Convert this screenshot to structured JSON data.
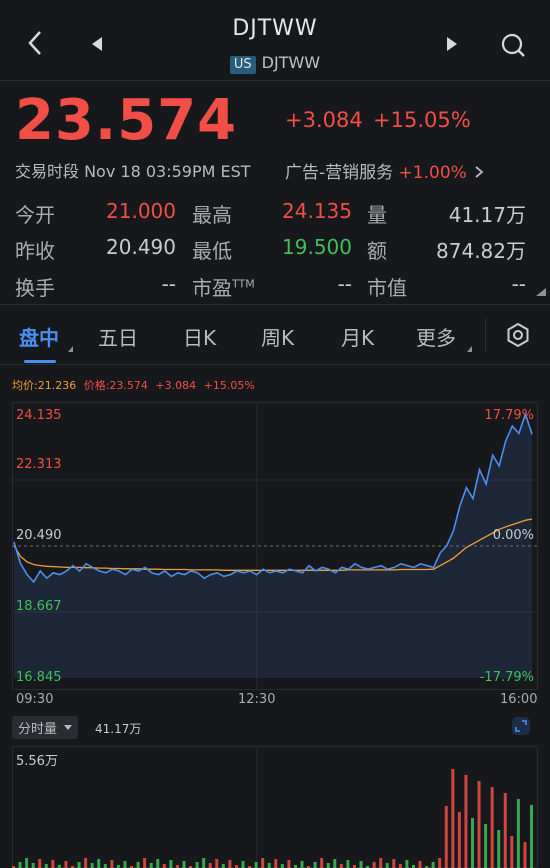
{
  "header": {
    "title": "DJTWW",
    "market_badge": "US",
    "subtitle": "DJTWW"
  },
  "quote": {
    "price": "23.574",
    "change": "+3.084",
    "change_pct": "+15.05%",
    "session": "交易时段 Nov 18 03:59PM EST",
    "sector_name": "广告-营销服务",
    "sector_change": "+1.00%"
  },
  "stats": {
    "open_label": "今开",
    "open_value": "21.000",
    "high_label": "最高",
    "high_value": "24.135",
    "volume_label": "量",
    "volume_value": "41.17万",
    "prev_label": "昨收",
    "prev_value": "20.490",
    "low_label": "最低",
    "low_value": "19.500",
    "amount_label": "额",
    "amount_value": "874.82万",
    "turnover_label": "换手",
    "turnover_value": "--",
    "pe_label": "市盈",
    "pe_sup": "TTM",
    "pe_value": "--",
    "mcap_label": "市值",
    "mcap_value": "--"
  },
  "tabs": {
    "intraday": "盘中",
    "five_day": "五日",
    "day_k": "日K",
    "week_k": "周K",
    "month_k": "月K",
    "more": "更多"
  },
  "legend": {
    "avg": "均价:21.236",
    "price": "价格:23.574",
    "change": "+3.084",
    "pct": "+15.05%"
  },
  "chart_data": {
    "type": "line",
    "y_labels_left": [
      "24.135",
      "22.313",
      "20.490",
      "18.667",
      "16.845"
    ],
    "y_labels_right": [
      "17.79%",
      "0.00%",
      "-17.79%"
    ],
    "x_labels": [
      "09:30",
      "12:30",
      "16:00"
    ],
    "ylim": [
      16.845,
      24.135
    ],
    "prev_close": 20.49,
    "series": [
      {
        "name": "价格",
        "values": [
          20.6,
          20.0,
          19.7,
          19.5,
          19.8,
          19.6,
          19.75,
          19.7,
          19.8,
          19.95,
          19.8,
          20.0,
          19.9,
          19.8,
          19.75,
          19.85,
          19.8,
          19.7,
          19.85,
          19.8,
          19.9,
          19.75,
          19.7,
          19.8,
          19.65,
          19.75,
          19.7,
          19.8,
          19.75,
          19.6,
          19.7,
          19.75,
          19.65,
          19.7,
          19.8,
          19.75,
          19.8,
          19.7,
          19.85,
          19.75,
          19.8,
          19.75,
          19.85,
          19.8,
          19.75,
          19.95,
          19.8,
          19.9,
          19.85,
          19.75,
          19.9,
          19.85,
          20.0,
          19.9,
          19.85,
          19.9,
          19.95,
          19.85,
          19.9,
          20.0,
          19.95,
          19.9,
          20.0,
          19.95,
          19.9,
          20.3,
          20.5,
          20.9,
          21.6,
          22.1,
          21.8,
          22.6,
          22.2,
          23.0,
          22.7,
          23.4,
          23.8,
          23.6,
          24.135,
          23.574
        ]
      },
      {
        "name": "均价",
        "values": [
          20.5,
          20.2,
          20.05,
          19.98,
          19.95,
          19.93,
          19.92,
          19.91,
          19.9,
          19.9,
          19.9,
          19.89,
          19.89,
          19.88,
          19.88,
          19.87,
          19.87,
          19.86,
          19.86,
          19.86,
          19.85,
          19.85,
          19.85,
          19.84,
          19.84,
          19.84,
          19.84,
          19.83,
          19.83,
          19.83,
          19.83,
          19.83,
          19.82,
          19.82,
          19.82,
          19.82,
          19.82,
          19.82,
          19.82,
          19.82,
          19.82,
          19.82,
          19.82,
          19.82,
          19.82,
          19.82,
          19.82,
          19.82,
          19.82,
          19.82,
          19.82,
          19.83,
          19.83,
          19.83,
          19.83,
          19.83,
          19.83,
          19.83,
          19.83,
          19.84,
          19.84,
          19.84,
          19.84,
          19.84,
          19.85,
          19.95,
          20.05,
          20.15,
          20.3,
          20.45,
          20.55,
          20.65,
          20.75,
          20.85,
          20.95,
          21.02,
          21.08,
          21.14,
          21.2,
          21.236
        ]
      }
    ]
  },
  "volume": {
    "selector": "分时量",
    "total": "41.17万",
    "max_label": "5.56万"
  },
  "colors": {
    "up": "#f04e46",
    "down": "#3fbf5a",
    "price_line": "#4a8ff0",
    "avg_line": "#f0a030",
    "accent": "#4a8ff0"
  }
}
